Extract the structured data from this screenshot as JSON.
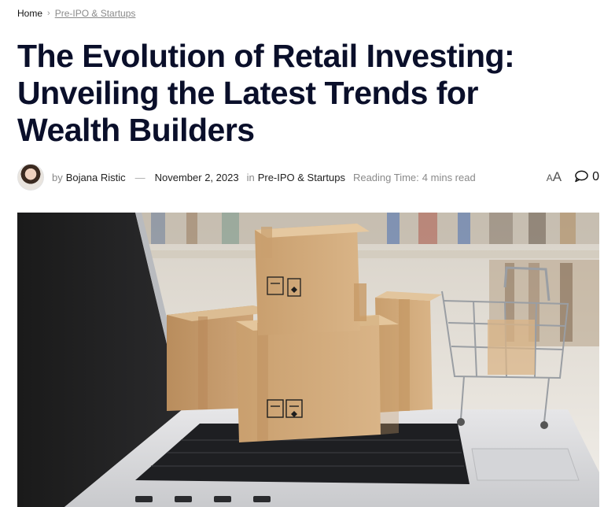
{
  "breadcrumb": {
    "home": "Home",
    "separator": "›",
    "current": "Pre-IPO & Startups"
  },
  "article": {
    "title": "The Evolution of Retail Investing: Unveiling the Latest Trends for Wealth Builders",
    "meta": {
      "by_label": "by",
      "author": "Bojana Ristic",
      "separator": "—",
      "date": "November 2, 2023",
      "in_label": "in",
      "category": "Pre-IPO & Startups",
      "reading_label": "Reading Time:",
      "reading_value": "4 mins read",
      "font_small": "A",
      "font_large": "A",
      "comment_count": "0"
    }
  },
  "icons": {
    "chevron": "chevron-right-icon",
    "comment": "comment-bubble-icon",
    "font_size": "font-size-icon"
  },
  "colors": {
    "title": "#0a0f2a",
    "muted": "#8a8a8a",
    "text": "#222222"
  }
}
